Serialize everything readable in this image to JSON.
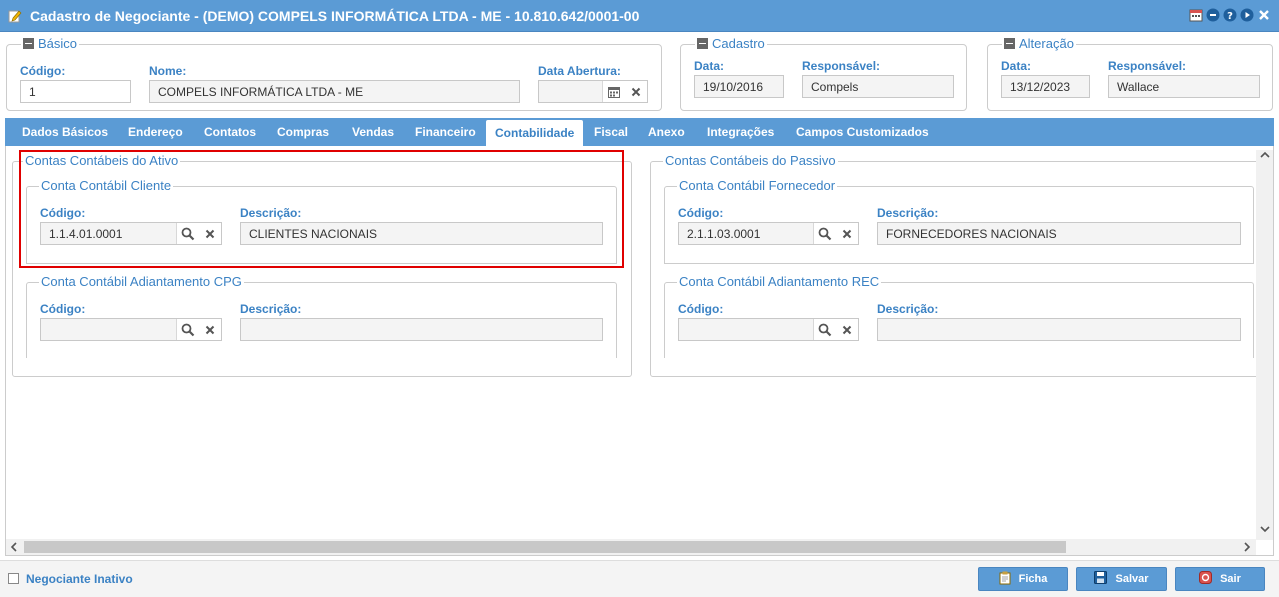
{
  "window": {
    "title": "Cadastro de Negociante - (DEMO) COMPELS INFORMÁTICA LTDA - ME - 10.810.642/0001-00",
    "icons": [
      "calendar-icon",
      "minimize-icon",
      "help-icon",
      "play-icon",
      "close-icon"
    ]
  },
  "basico": {
    "legend": "Básico",
    "codigo_label": "Código:",
    "codigo_value": "1",
    "nome_label": "Nome:",
    "nome_value": "COMPELS INFORMÁTICA LTDA - ME",
    "abertura_label": "Data Abertura:",
    "abertura_value": ""
  },
  "cadastro": {
    "legend": "Cadastro",
    "data_label": "Data:",
    "data_value": "19/10/2016",
    "resp_label": "Responsável:",
    "resp_value": "Compels"
  },
  "alteracao": {
    "legend": "Alteração",
    "data_label": "Data:",
    "data_value": "13/12/2023",
    "resp_label": "Responsável:",
    "resp_value": "Wallace"
  },
  "tabs": [
    {
      "label": "Dados Básicos"
    },
    {
      "label": "Endereço"
    },
    {
      "label": "Contatos"
    },
    {
      "label": "Compras"
    },
    {
      "label": "Vendas"
    },
    {
      "label": "Financeiro"
    },
    {
      "label": "Contabilidade",
      "active": true
    },
    {
      "label": "Fiscal"
    },
    {
      "label": "Anexo"
    },
    {
      "label": "Integrações"
    },
    {
      "label": "Campos Customizados"
    }
  ],
  "ativo": {
    "legend": "Contas Contábeis do Ativo",
    "cliente": {
      "legend": "Conta Contábil Cliente",
      "codigo_label": "Código:",
      "codigo_value": "1.1.4.01.0001",
      "descricao_label": "Descrição:",
      "descricao_value": "CLIENTES NACIONAIS"
    },
    "adiantamento": {
      "legend": "Conta Contábil Adiantamento CPG",
      "codigo_label": "Código:",
      "codigo_value": "",
      "descricao_label": "Descrição:",
      "descricao_value": ""
    }
  },
  "passivo": {
    "legend": "Contas Contábeis do Passivo",
    "fornecedor": {
      "legend": "Conta Contábil Fornecedor",
      "codigo_label": "Código:",
      "codigo_value": "2.1.1.03.0001",
      "descricao_label": "Descrição:",
      "descricao_value": "FORNECEDORES NACIONAIS"
    },
    "adiantamento": {
      "legend": "Conta Contábil Adiantamento REC",
      "codigo_label": "Código:",
      "codigo_value": "",
      "descricao_label": "Descrição:",
      "descricao_value": ""
    }
  },
  "footer": {
    "inativo_label": "Negociante Inativo",
    "ficha_label": "Ficha",
    "salvar_label": "Salvar",
    "sair_label": "Sair"
  },
  "colors": {
    "accent": "#5b9bd5",
    "label": "#3b82c4",
    "highlight": "#e00000"
  }
}
